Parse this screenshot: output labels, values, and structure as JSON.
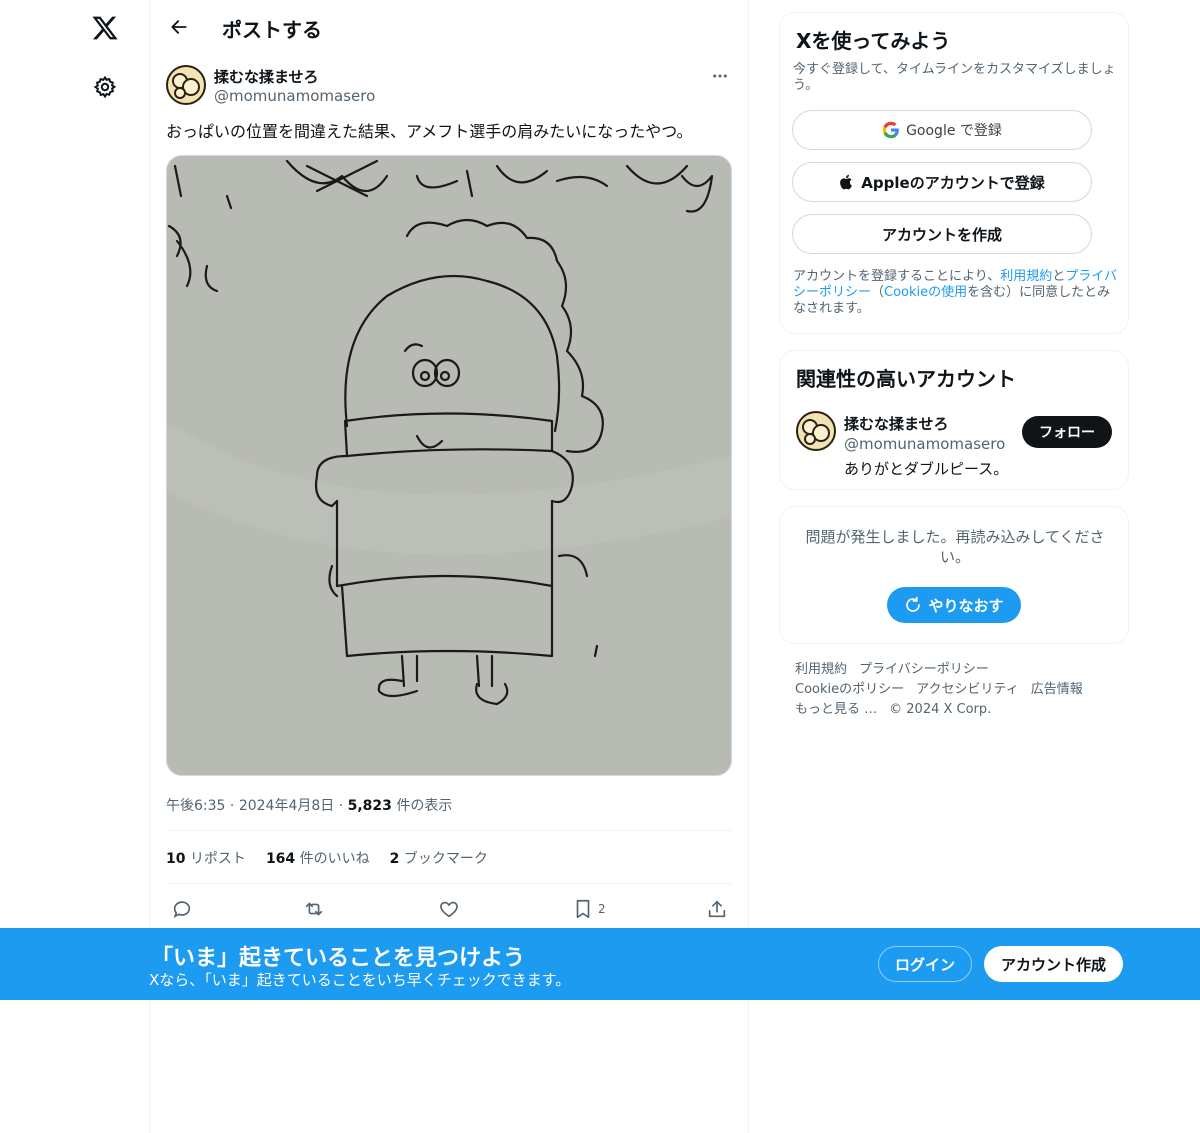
{
  "nav": {
    "logo_icon": "x-logo-icon",
    "settings_icon": "gear-icon"
  },
  "header": {
    "back_icon": "arrow-left-icon",
    "title": "ポストする"
  },
  "tweet": {
    "author_name": "揉むな揉ませろ",
    "author_handle": "@momunamomasero",
    "text": "おっぱいの位置を間違えた結果、アメフト選手の肩みたいになったやつ。",
    "time": "午後6:35",
    "date": "2024年4月8日",
    "views_count": "5,823",
    "views_label": "件の表示",
    "reposts_count": "10",
    "reposts_label": "リポスト",
    "likes_count": "164",
    "likes_label": "件のいいね",
    "bookmarks_count": "2",
    "bookmarks_label": "ブックマーク",
    "action_bookmark_count": "2"
  },
  "signup_card": {
    "title": "Xを使ってみよう",
    "subtitle": "今すぐ登録して、タイムラインをカスタマイズしましょう。",
    "google_label": "Google で登録",
    "apple_label": "Appleのアカウントで登録",
    "create_label": "アカウントを作成",
    "legal_pre": "アカウントを登録することにより、",
    "legal_terms": "利用規約",
    "legal_and": "と",
    "legal_privacy": "プライバシーポリシー",
    "legal_open": "（",
    "legal_cookie": "Cookieの使用",
    "legal_post": "を含む）に同意したとみなされます。"
  },
  "related": {
    "title": "関連性の高いアカウント",
    "name": "揉むな揉ませろ",
    "handle": "@momunamomasero",
    "bio": "ありがとダブルピース。",
    "follow_label": "フォロー"
  },
  "error_card": {
    "message": "問題が発生しました。再読み込みしてください。",
    "retry_label": "やりなおす"
  },
  "footer": {
    "links": [
      "利用規約",
      "プライバシーポリシー",
      "Cookieのポリシー",
      "アクセシビリティ",
      "広告情報",
      "もっと見る …"
    ],
    "copyright": "© 2024 X Corp."
  },
  "banner": {
    "title": "「いま」起きていることを見つけよう",
    "subtitle": "Xなら、「いま」起きていることをいち早くチェックできます。",
    "login_label": "ログイン",
    "signup_label": "アカウント作成"
  },
  "colors": {
    "accent": "#1d9bf0",
    "text": "#0f1419",
    "secondary": "#536471",
    "border": "#eff3f4"
  }
}
